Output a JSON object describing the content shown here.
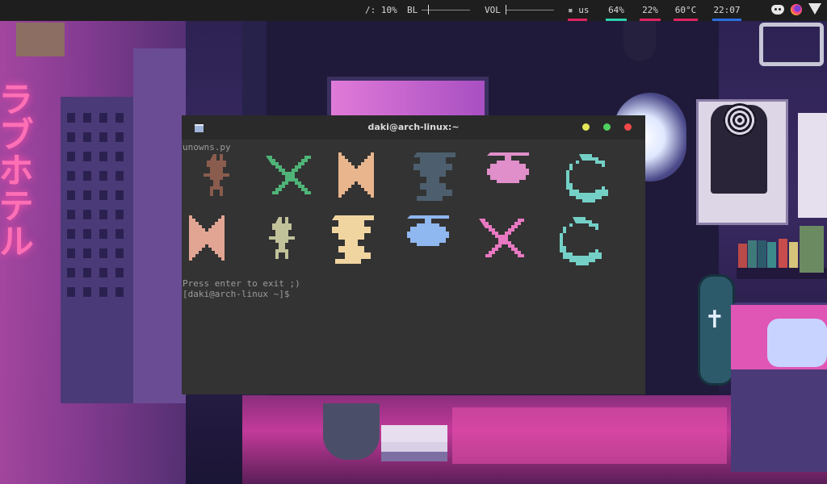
{
  "topbar": {
    "cpu": "/: 10%",
    "bl_label": "BL",
    "vol_label": "VOL",
    "keyboard": "us",
    "stat1": "64%",
    "stat2": "22%",
    "temp": "60°C",
    "time": "22:07",
    "underline_colors": {
      "keyboard": "#e0245e",
      "stat1": "#2fd0b0",
      "stat2": "#e0245e",
      "temp": "#e0245e",
      "time": "#2a6fe0"
    },
    "tray_icons": [
      "discord-icon",
      "firefox-icon",
      "wifi-icon"
    ]
  },
  "terminal": {
    "title": "daki@arch-linux:~",
    "command": "unowns.py",
    "exit_message": "Press enter to exit ;)",
    "prompt": "[daki@arch-linux ~]$",
    "buttons": {
      "minimize_color": "#e6e65a",
      "maximize_color": "#4fd160",
      "close_color": "#f0484a"
    },
    "glyphs_row1": [
      {
        "icon": "unown-glyph-icon",
        "color": "#8a5c4e"
      },
      {
        "icon": "unown-glyph-icon",
        "color": "#4fb377"
      },
      {
        "icon": "unown-glyph-icon",
        "color": "#e8b58d"
      },
      {
        "icon": "unown-glyph-icon",
        "color": "#4d5f6e"
      },
      {
        "icon": "unown-glyph-icon",
        "color": "#e08fca"
      },
      {
        "icon": "unown-glyph-icon",
        "color": "#74d0c6"
      }
    ],
    "glyphs_row2": [
      {
        "icon": "unown-glyph-icon",
        "color": "#e2a594"
      },
      {
        "icon": "unown-glyph-icon",
        "color": "#c2c29a"
      },
      {
        "icon": "unown-glyph-icon",
        "color": "#f1d5a0"
      },
      {
        "icon": "unown-glyph-icon",
        "color": "#8fb7f0"
      },
      {
        "icon": "unown-glyph-icon",
        "color": "#e878c2"
      },
      {
        "icon": "unown-glyph-icon",
        "color": "#74d0c6"
      }
    ]
  },
  "wallpaper": {
    "sign_text": "ラブホテル"
  }
}
